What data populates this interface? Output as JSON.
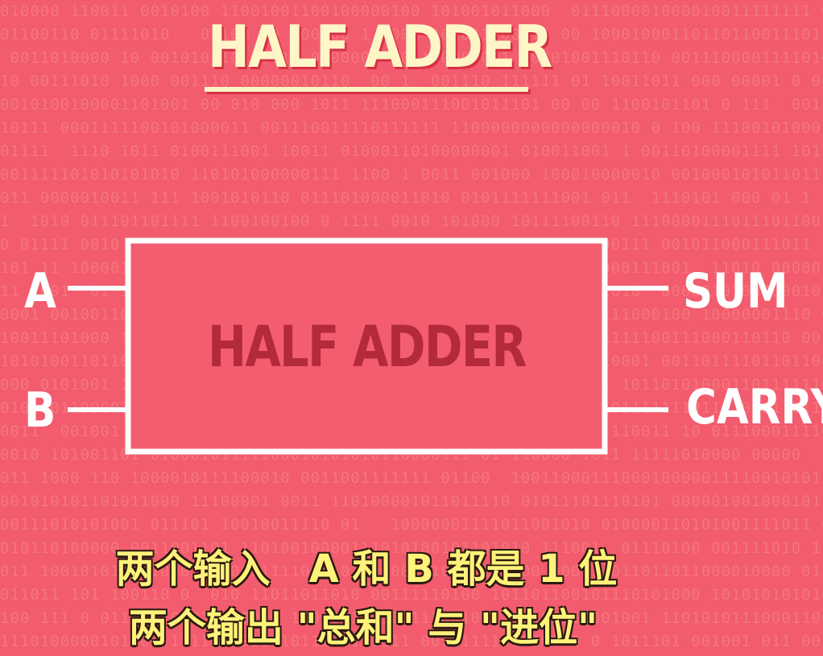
{
  "title": "HALF ADDER",
  "block": {
    "label": "HALF ADDER"
  },
  "inputs": [
    {
      "label": "A"
    },
    {
      "label": "B"
    }
  ],
  "outputs": [
    {
      "label": "SUM"
    },
    {
      "label": "CARRY"
    }
  ],
  "subtitles": [
    "两个输入　A 和 B 都是 1 位",
    "两个输出 \"总和\" 与 \"进位\""
  ],
  "colors": {
    "background": "#f25c6e",
    "block_fill": "#f45d70",
    "block_border": "#ffffff",
    "block_text": "#b32a3a",
    "title": "#fff6c8",
    "subtitle": "#fff27a"
  }
}
